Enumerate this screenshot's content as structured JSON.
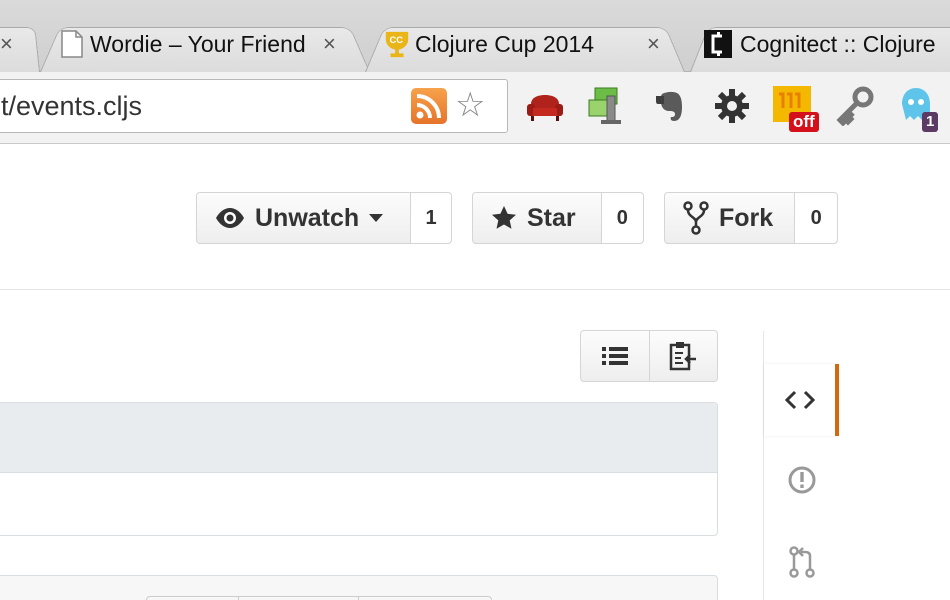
{
  "browser": {
    "tabs": [
      {
        "title": "Wordie – Your Friend",
        "favicon": "page-icon",
        "close": "×"
      },
      {
        "title": "Clojure Cup 2014",
        "favicon": "clojure-cup-icon",
        "close": "×"
      },
      {
        "title": "Cognitect :: Clojure",
        "favicon": "cognitect-icon",
        "close": ""
      }
    ],
    "first_tab_close": "×",
    "address_bar": {
      "url": "t/events.cljs"
    },
    "extensions": [
      {
        "name": "sofa-icon"
      },
      {
        "name": "network-monitor-icon"
      },
      {
        "name": "evernote-icon"
      },
      {
        "name": "settings-gear-icon"
      },
      {
        "name": "off-extension-icon",
        "badge": "off"
      },
      {
        "name": "key-icon"
      },
      {
        "name": "ghostery-icon",
        "badge": "1"
      }
    ]
  },
  "repo_actions": {
    "watch": {
      "label": "Unwatch",
      "count": "1"
    },
    "star": {
      "label": "Star",
      "count": "0"
    },
    "fork": {
      "label": "Fork",
      "count": "0"
    }
  },
  "file_view": {
    "view_buttons": [
      "list-icon",
      "clipboard-icon"
    ]
  },
  "side_nav": {
    "items": [
      "code-icon",
      "issues-icon",
      "pull-request-icon"
    ],
    "active": "code-icon"
  },
  "colors": {
    "active_nav_accent": "#d26911",
    "rss_orange": "#f08a32"
  }
}
